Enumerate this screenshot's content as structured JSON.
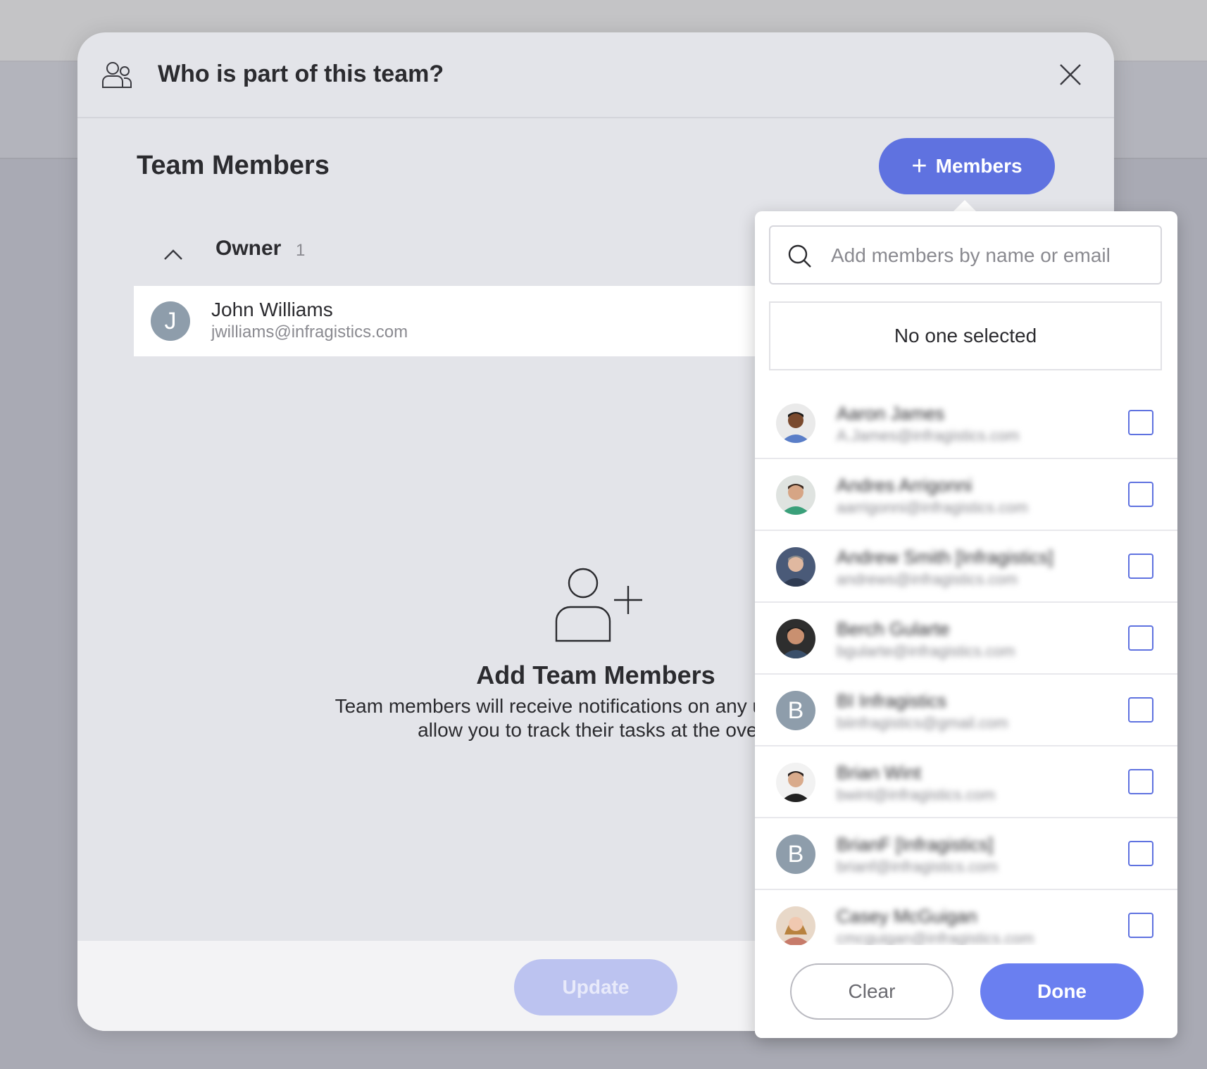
{
  "dialog": {
    "title": "Who is part of this team?",
    "section_title": "Team Members",
    "add_members_label": "Members",
    "owner_group": {
      "label": "Owner",
      "count": "1"
    },
    "owner": {
      "initial": "J",
      "name": "John Williams",
      "email": "jwilliams@infragistics.com"
    },
    "empty_state": {
      "title": "Add Team Members",
      "line1": "Team members will receive notifications on any update. Adc",
      "line2": "allow you to track their tasks at the overv"
    },
    "update_label": "Update"
  },
  "picker": {
    "search_placeholder": "Add members by name or email",
    "selection_text": "No one selected",
    "members": [
      {
        "name": "Aaron James",
        "email": "A.James@infragistics.com",
        "avatar": "photo",
        "checked": false
      },
      {
        "name": "Andres Arrigonni",
        "email": "aarrigonni@infragistics.com",
        "avatar": "photo",
        "checked": false
      },
      {
        "name": "Andrew Smith [Infragistics]",
        "email": "andrews@infragistics.com",
        "avatar": "photo",
        "checked": false
      },
      {
        "name": "Berch Gularte",
        "email": "bgularte@infragistics.com",
        "avatar": "photo",
        "checked": false
      },
      {
        "name": "BI Infragistics",
        "email": "biinfragistics@gmail.com",
        "avatar": "B",
        "checked": false
      },
      {
        "name": "Brian Wint",
        "email": "bwint@infragistics.com",
        "avatar": "photo",
        "checked": false
      },
      {
        "name": "BrianF [Infragistics]",
        "email": "brianf@infragistics.com",
        "avatar": "B",
        "checked": false
      },
      {
        "name": "Casey McGuigan",
        "email": "cmcguigan@infragistics.com",
        "avatar": "photo",
        "checked": false
      }
    ],
    "clear_label": "Clear",
    "done_label": "Done"
  },
  "colors": {
    "accent": "#5f72e0",
    "avatar_bg": "#8e9dab",
    "dialog_bg": "#e3e4e9"
  }
}
